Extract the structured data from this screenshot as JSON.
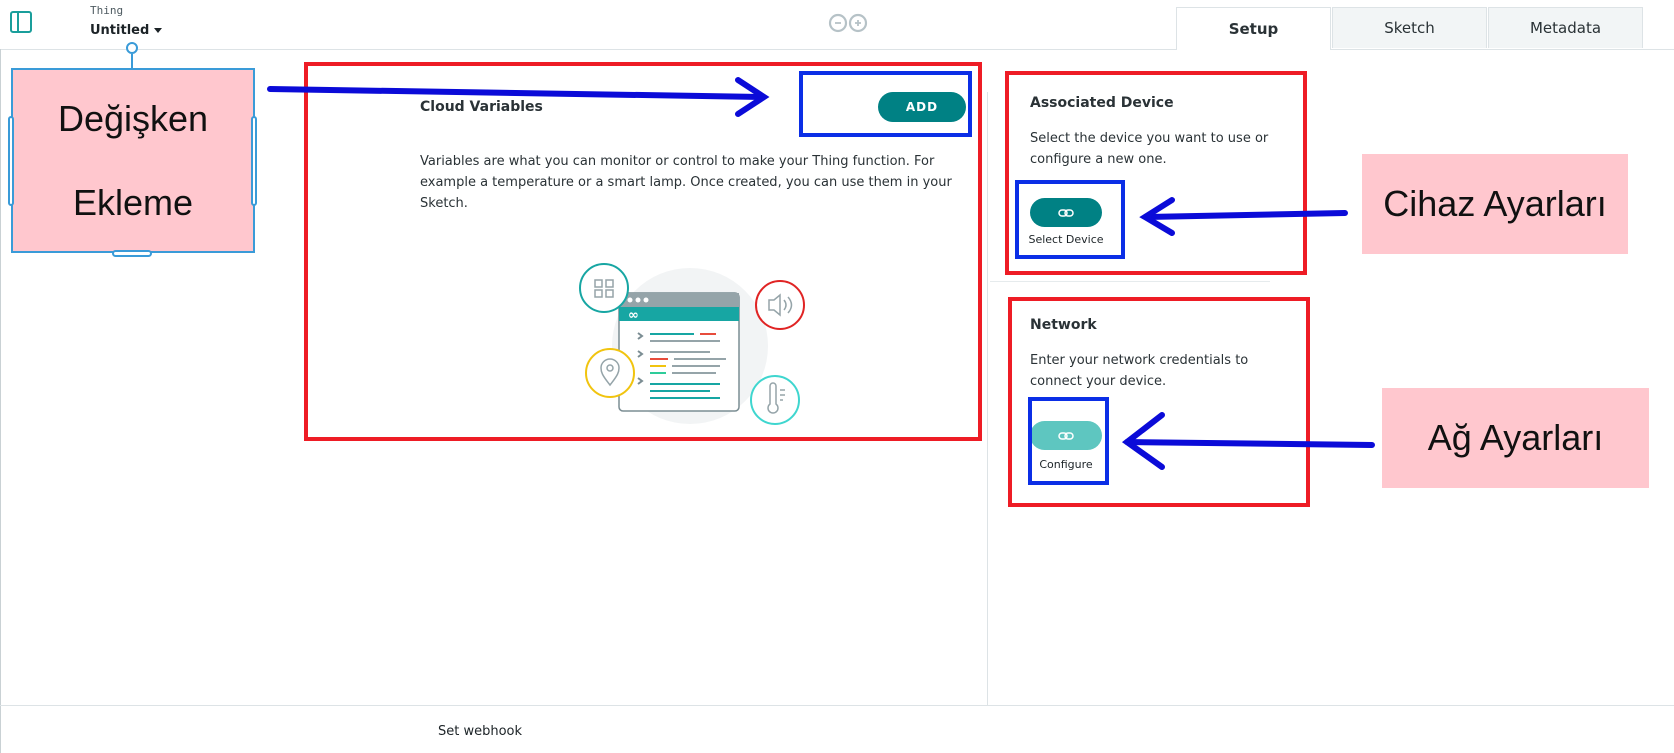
{
  "header": {
    "thing_label": "Thing",
    "thing_name": "Untitled",
    "tabs": [
      "Setup",
      "Sketch",
      "Metadata"
    ],
    "active_tab": "Setup"
  },
  "cloud_variables": {
    "title": "Cloud Variables",
    "add_label": "ADD",
    "description": "Variables are what you can monitor or control to make your Thing function. For example a temperature or a smart lamp. Once created, you can use them in your Sketch."
  },
  "associated_device": {
    "title": "Associated Device",
    "description": "Select the device you want to use or configure a new one.",
    "button_label": "Select Device"
  },
  "network": {
    "title": "Network",
    "description": "Enter your network credentials to connect your device.",
    "button_label": "Configure"
  },
  "footer": {
    "webhook_label": "Set webhook"
  },
  "annotations": {
    "add_note_line1": "Değişken",
    "add_note_line2": "Ekleme",
    "device_note": "Cihaz Ayarları",
    "network_note": "Ağ Ayarları"
  },
  "colors": {
    "teal": "#008184",
    "teal_light": "#5ec6c0",
    "annotation_red": "#ee1c25",
    "annotation_blue": "#0b2ee6",
    "note_pink": "#ffc7ce"
  }
}
